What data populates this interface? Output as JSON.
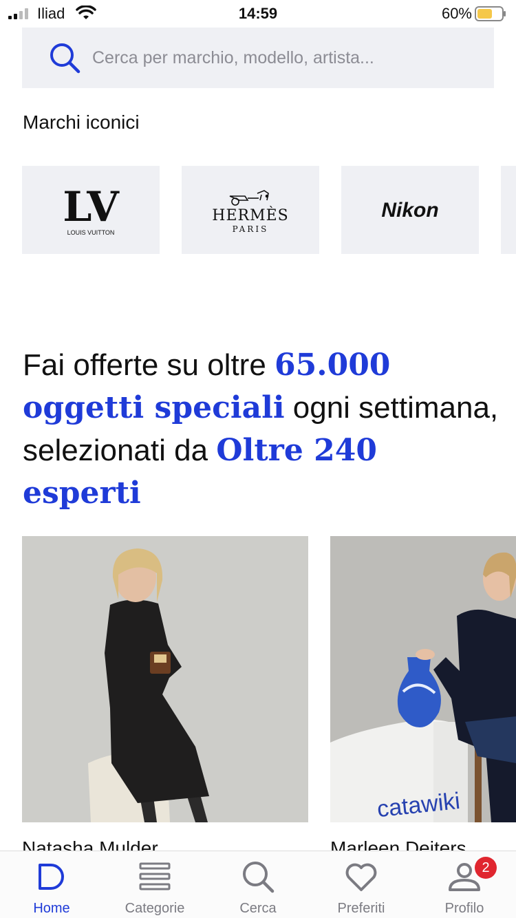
{
  "status_bar": {
    "carrier": "Iliad",
    "time": "14:59",
    "battery": "60%"
  },
  "search": {
    "placeholder": "Cerca per marchio, modello, artista..."
  },
  "brands_section": {
    "title": "Marchi iconici",
    "brands": [
      {
        "name": "LV",
        "subtitle": "LOUIS VUITTON"
      },
      {
        "name": "HERMÈS",
        "subtitle": "PARIS"
      },
      {
        "name": "Nikon"
      }
    ]
  },
  "headline": {
    "part1": "Fai offerte su oltre ",
    "accent1": "65.000 oggetti speciali",
    "part2": " ogni settimana, selezionati da ",
    "accent2": "Oltre 240 esperti"
  },
  "experts": [
    {
      "name": "Natasha Mulder"
    },
    {
      "name": "Marleen Deiters",
      "brand_on_pedestal": "catawiki"
    }
  ],
  "bottom_nav": {
    "items": [
      {
        "label": "Home",
        "icon": "home-icon",
        "active": true
      },
      {
        "label": "Categorie",
        "icon": "categories-icon"
      },
      {
        "label": "Cerca",
        "icon": "search-icon"
      },
      {
        "label": "Preferiti",
        "icon": "heart-icon"
      },
      {
        "label": "Profilo",
        "icon": "profile-icon",
        "badge": "2"
      }
    ]
  },
  "colors": {
    "accent": "#1f3bd8",
    "tile_background": "#eff0f4",
    "badge": "#e0262f"
  }
}
